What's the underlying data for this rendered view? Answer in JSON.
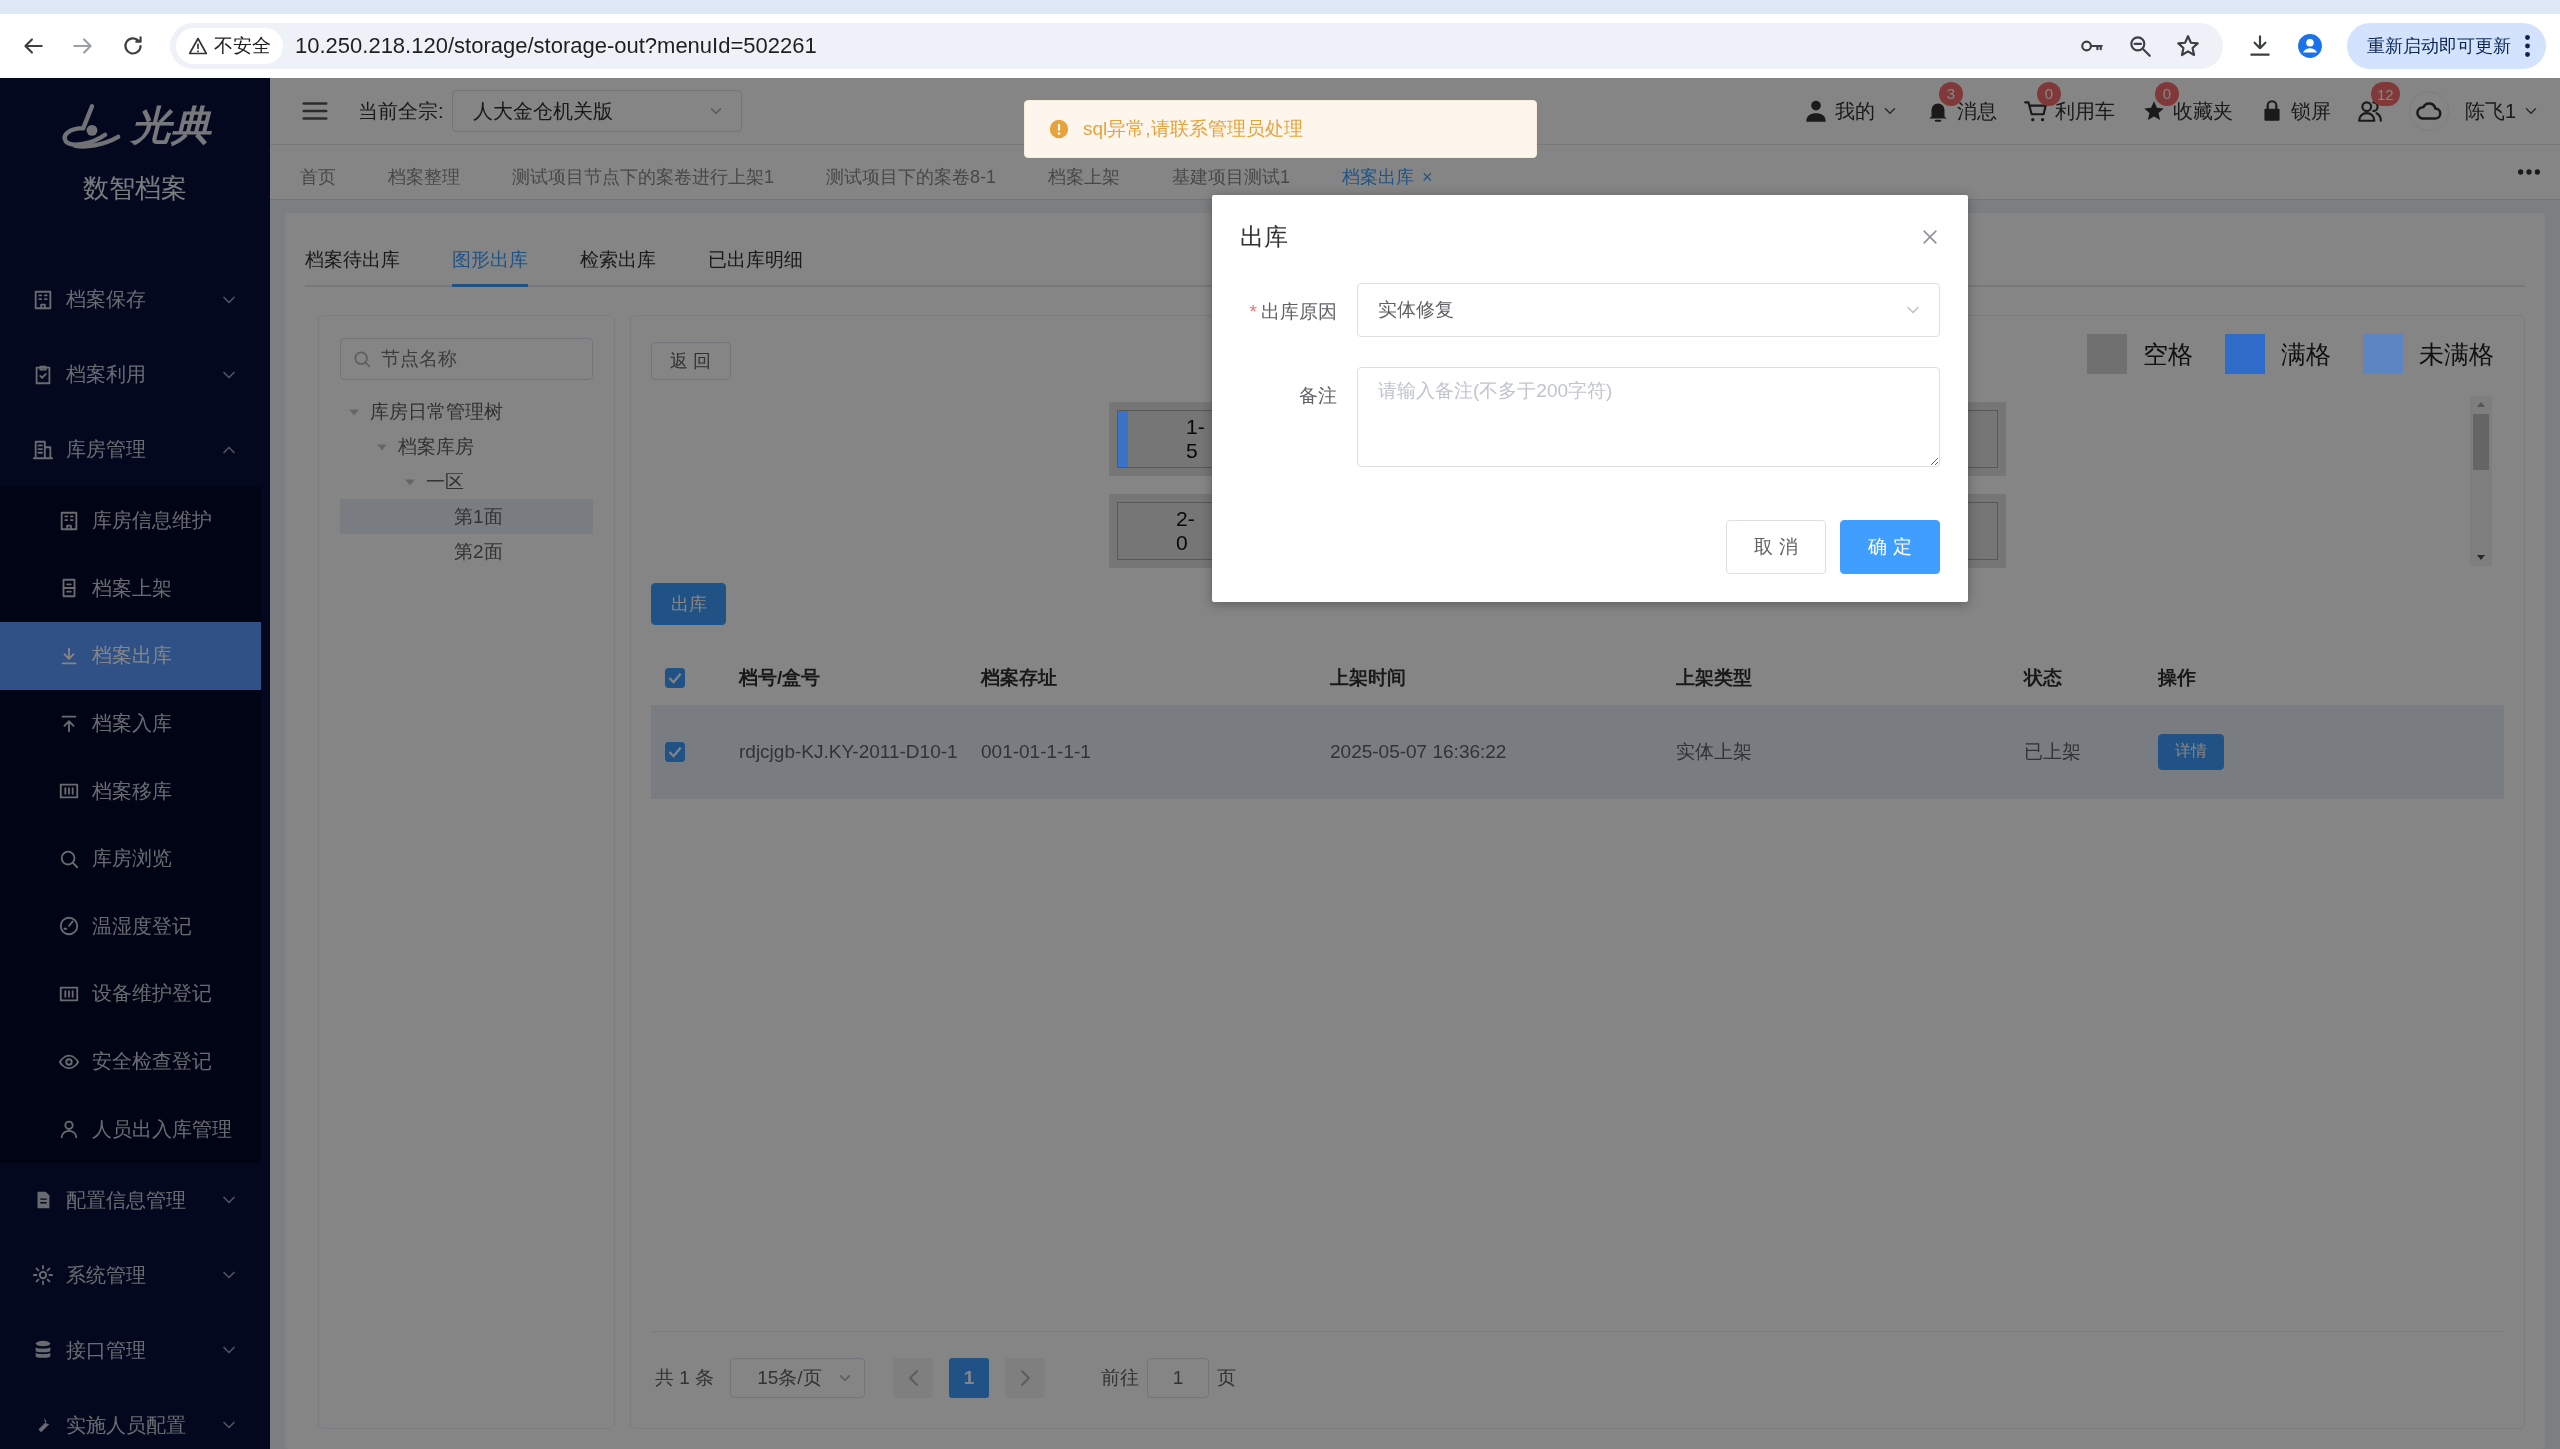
{
  "browser": {
    "security": "不安全",
    "url": "10.250.218.120/storage/storage-out?menuId=502261",
    "update_button": "重新启动即可更新"
  },
  "sidebar": {
    "logo": "光典",
    "subtitle": "数智档案",
    "items": [
      {
        "label": "档案保存",
        "expanded": false
      },
      {
        "label": "档案利用",
        "expanded": false
      },
      {
        "label": "库房管理",
        "expanded": true,
        "children": [
          {
            "label": "库房信息维护",
            "selected": false
          },
          {
            "label": "档案上架",
            "selected": false
          },
          {
            "label": "档案出库",
            "selected": true
          },
          {
            "label": "档案入库",
            "selected": false
          },
          {
            "label": "档案移库",
            "selected": false
          },
          {
            "label": "库房浏览",
            "selected": false
          },
          {
            "label": "温湿度登记",
            "selected": false
          },
          {
            "label": "设备维护登记",
            "selected": false
          },
          {
            "label": "安全检查登记",
            "selected": false
          },
          {
            "label": "人员出入库管理",
            "selected": false
          }
        ]
      },
      {
        "label": "配置信息管理",
        "expanded": false
      },
      {
        "label": "系统管理",
        "expanded": false
      },
      {
        "label": "接口管理",
        "expanded": false
      },
      {
        "label": "实施人员配置",
        "expanded": false
      }
    ]
  },
  "header": {
    "fonds_label": "当前全宗:",
    "fonds_value": "人大金仓机关版",
    "tools": [
      {
        "label": "我的"
      },
      {
        "label": "消息",
        "badge": "3"
      },
      {
        "label": "利用车",
        "badge": "0"
      },
      {
        "label": "收藏夹",
        "badge": "0"
      },
      {
        "label": "锁屏"
      },
      {
        "badge": "12"
      }
    ],
    "user": "陈飞1"
  },
  "tabs": [
    {
      "label": "首页",
      "selected": false
    },
    {
      "label": "档案整理",
      "selected": false
    },
    {
      "label": "测试项目节点下的案卷进行上架1",
      "selected": false
    },
    {
      "label": "测试项目下的案卷8-1",
      "selected": false
    },
    {
      "label": "档案上架",
      "selected": false
    },
    {
      "label": "基建项目测试1",
      "selected": false
    },
    {
      "label": "档案出库",
      "selected": true,
      "close": "×"
    }
  ],
  "toast": {
    "message": "sql异常,请联系管理员处理"
  },
  "subtabs": [
    {
      "label": "档案待出库",
      "selected": false
    },
    {
      "label": "图形出库",
      "selected": true
    },
    {
      "label": "检索出库",
      "selected": false
    },
    {
      "label": "已出库明细",
      "selected": false
    }
  ],
  "tree": {
    "placeholder": "节点名称",
    "nodes": [
      {
        "label": "库房日常管理树",
        "expanded": true,
        "selected": false,
        "children": [
          {
            "label": "档案库房",
            "expanded": true,
            "selected": false,
            "children": [
              {
                "label": "一区",
                "expanded": true,
                "selected": false,
                "children": [
                  {
                    "label": "第1面",
                    "selected": true
                  },
                  {
                    "label": "第2面",
                    "selected": false
                  }
                ]
              }
            ]
          }
        ]
      }
    ]
  },
  "panel": {
    "back_button": "返 回",
    "out_button": "出库",
    "legend": [
      {
        "label": "空格",
        "color": "#707070"
      },
      {
        "label": "满格",
        "color": "#2f6bc9"
      },
      {
        "label": "未满格",
        "color": "#5b86c2"
      }
    ],
    "shelves": [
      {
        "title": "1-",
        "count": "5",
        "color": "#3b73c9"
      },
      {
        "title": "2-",
        "count": "0"
      }
    ]
  },
  "table": {
    "all_checked": true,
    "columns": [
      "档号/盒号",
      "档案存址",
      "上架时间",
      "上架类型",
      "状态",
      "操作"
    ],
    "rows": [
      {
        "checked": true,
        "selected": true,
        "cells": [
          "rdjcjgb-KJ.KY-2011-D10-1",
          "001-01-1-1-1",
          "2025-05-07 16:36:22",
          "实体上架",
          "已上架"
        ],
        "action": "详情"
      }
    ]
  },
  "pagination": {
    "total": "共 1 条",
    "page_size": "15条/页",
    "pages": [
      {
        "label": "1",
        "selected": true
      }
    ],
    "jump_label": "前往",
    "jump_value": "1",
    "jump_suffix": "页"
  },
  "modal": {
    "title": "出库",
    "fields": [
      {
        "kind": "select",
        "label": "出库原因",
        "required_mark": "*",
        "value": "实体修复"
      },
      {
        "kind": "textarea",
        "label": "备注",
        "placeholder": "请输入备注(不多于200字符)"
      }
    ],
    "buttons": [
      {
        "label": "取 消",
        "primary": false
      },
      {
        "label": "确 定",
        "primary": true
      }
    ]
  }
}
